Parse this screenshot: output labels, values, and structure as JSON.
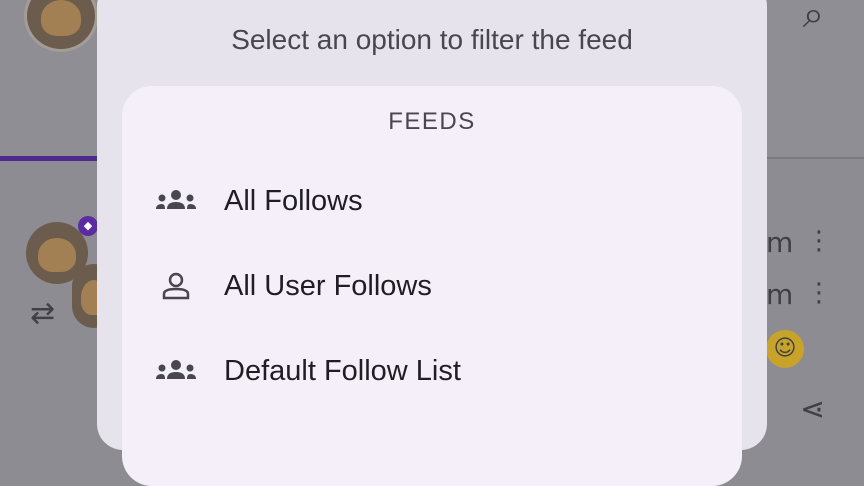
{
  "dialog": {
    "title": "Select an option to filter the feed",
    "section_title": "FEEDS",
    "options": [
      {
        "label": "All Follows",
        "icon": "group-icon"
      },
      {
        "label": "All User Follows",
        "icon": "person-icon"
      },
      {
        "label": "Default Follow List",
        "icon": "group-icon"
      }
    ]
  },
  "background": {
    "visible_fragments": [
      "m",
      "m"
    ],
    "accent_color": "#4f2a8e"
  }
}
